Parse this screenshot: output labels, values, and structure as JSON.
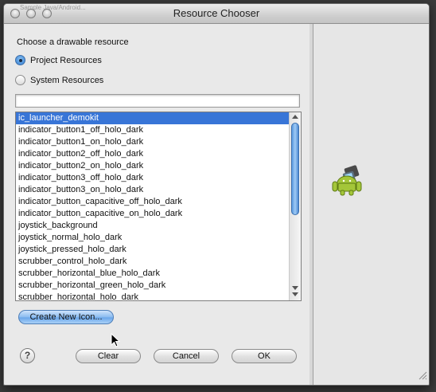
{
  "window": {
    "title": "Resource Chooser",
    "ghost_title": "Sample Java/Android..."
  },
  "dialog": {
    "prompt": "Choose a drawable resource",
    "radios": [
      {
        "label": "Project Resources",
        "selected": true
      },
      {
        "label": "System Resources",
        "selected": false
      }
    ],
    "filter": {
      "value": "",
      "placeholder": ""
    },
    "resources": [
      "ic_launcher_demokit",
      "indicator_button1_off_holo_dark",
      "indicator_button1_on_holo_dark",
      "indicator_button2_off_holo_dark",
      "indicator_button2_on_holo_dark",
      "indicator_button3_off_holo_dark",
      "indicator_button3_on_holo_dark",
      "indicator_button_capacitive_off_holo_dark",
      "indicator_button_capacitive_on_holo_dark",
      "joystick_background",
      "joystick_normal_holo_dark",
      "joystick_pressed_holo_dark",
      "scrubber_control_holo_dark",
      "scrubber_horizontal_blue_holo_dark",
      "scrubber_horizontal_green_holo_dark",
      "scrubber_horizontal_holo_dark"
    ],
    "selected_index": 0,
    "create_icon_label": "Create New Icon...",
    "help_label": "?",
    "buttons": {
      "clear": "Clear",
      "cancel": "Cancel",
      "ok": "OK"
    }
  },
  "preview": {
    "icon": "android-robot-icon"
  },
  "colors": {
    "selection": "#3875d7",
    "accent_blue": "#6aa6ea"
  }
}
